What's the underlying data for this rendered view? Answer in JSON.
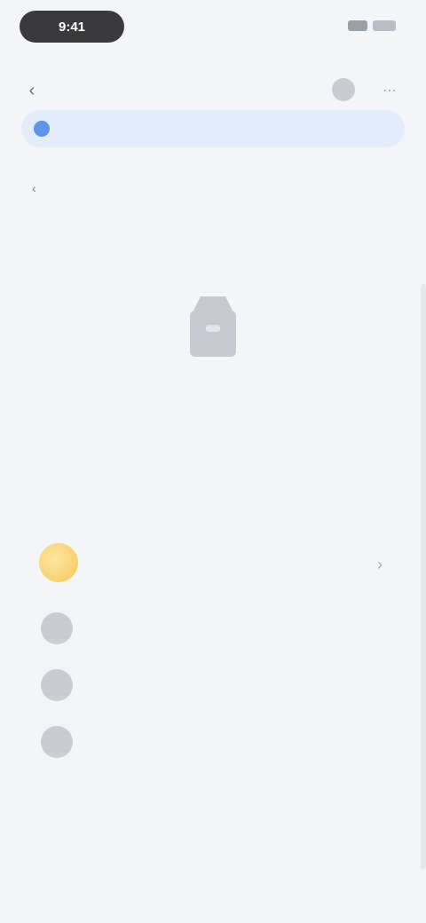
{
  "status_bar": {
    "time": "9:41"
  },
  "header": {
    "title": "",
    "back_icon": "chevron-left-icon",
    "action_icon_a": "avatar-icon",
    "action_icon_b": "more-icon"
  },
  "banner": {
    "icon": "info-icon",
    "text": ""
  },
  "section": {
    "label": ""
  },
  "tabs": [
    {
      "label": ""
    },
    {
      "label": ""
    },
    {
      "label": ""
    }
  ],
  "empty_state": {
    "illustration": "empty-box-icon",
    "text_line1": "",
    "text_line2": ""
  },
  "card": {
    "title": "",
    "link": ""
  },
  "main_coin": {
    "name": "",
    "sub": "",
    "action_icon": "chevron-right-icon"
  },
  "coins": [
    {
      "name": "",
      "sub": "",
      "change": "",
      "value": "",
      "value_sub": ""
    },
    {
      "name": "",
      "sub": "",
      "change": "",
      "value": "",
      "value_sub": ""
    },
    {
      "name": "",
      "sub": "",
      "change": "",
      "value": "",
      "value_sub": ""
    }
  ],
  "footer": {
    "indicator": ""
  },
  "colors": {
    "accent": "#5f95e8",
    "positive": "#8fd3a0",
    "gold": "#f5c85a"
  }
}
